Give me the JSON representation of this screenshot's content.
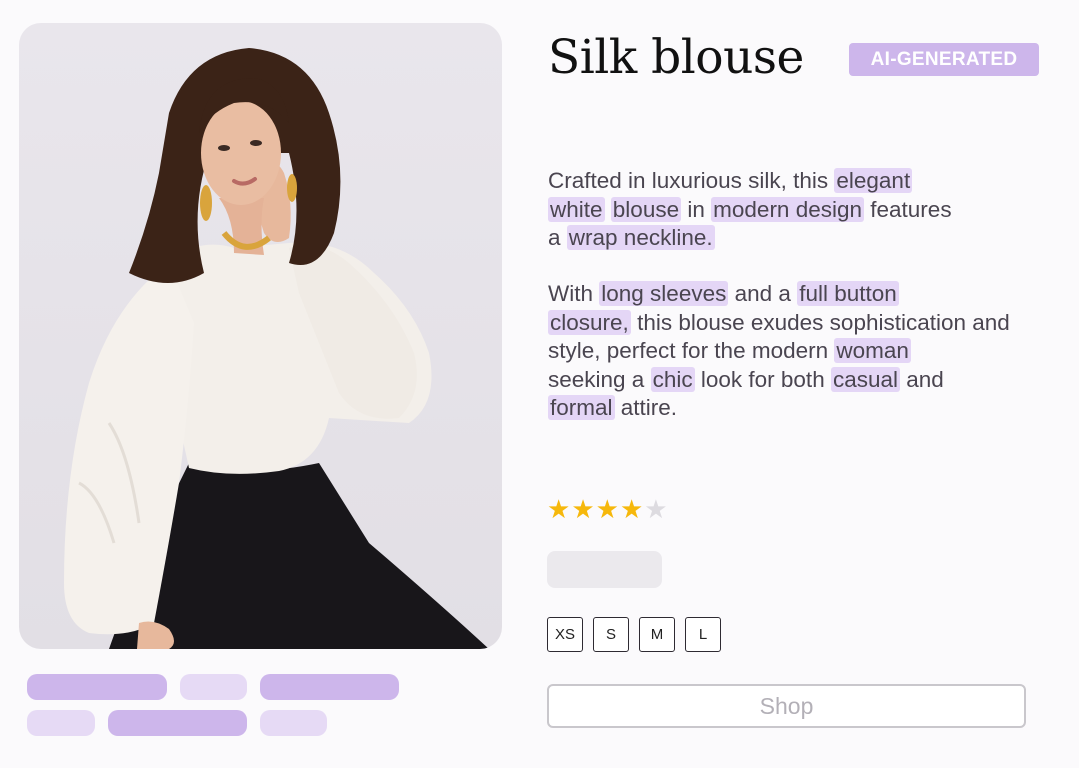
{
  "product": {
    "title": "Silk blouse",
    "badge": "AI-GENERATED",
    "image_alt_icon": "model-photo",
    "description": {
      "p1": [
        "Crafted in luxurious silk, this",
        "elegant",
        "white",
        "blouse",
        "in",
        "modern design",
        "features",
        "a",
        "wrap neckline."
      ],
      "p2": [
        "With",
        "long sleeves",
        "and a",
        "full button",
        "closure,",
        "this blouse exudes sophistication and style, perfect for the modern",
        "woman",
        "seeking a",
        "chic",
        "look for both",
        "casual",
        "and",
        "formal",
        "attire."
      ]
    },
    "rating": {
      "value": 4,
      "max": 5,
      "star_on": "★",
      "star_off": "★"
    },
    "sizes": [
      "XS",
      "S",
      "M",
      "L"
    ],
    "shop_label": "Shop"
  },
  "colors": {
    "accent": "#cdb6eb",
    "accent_light": "#e6daf5",
    "highlight": "#e4d6f6",
    "star": "#f6b80c"
  }
}
